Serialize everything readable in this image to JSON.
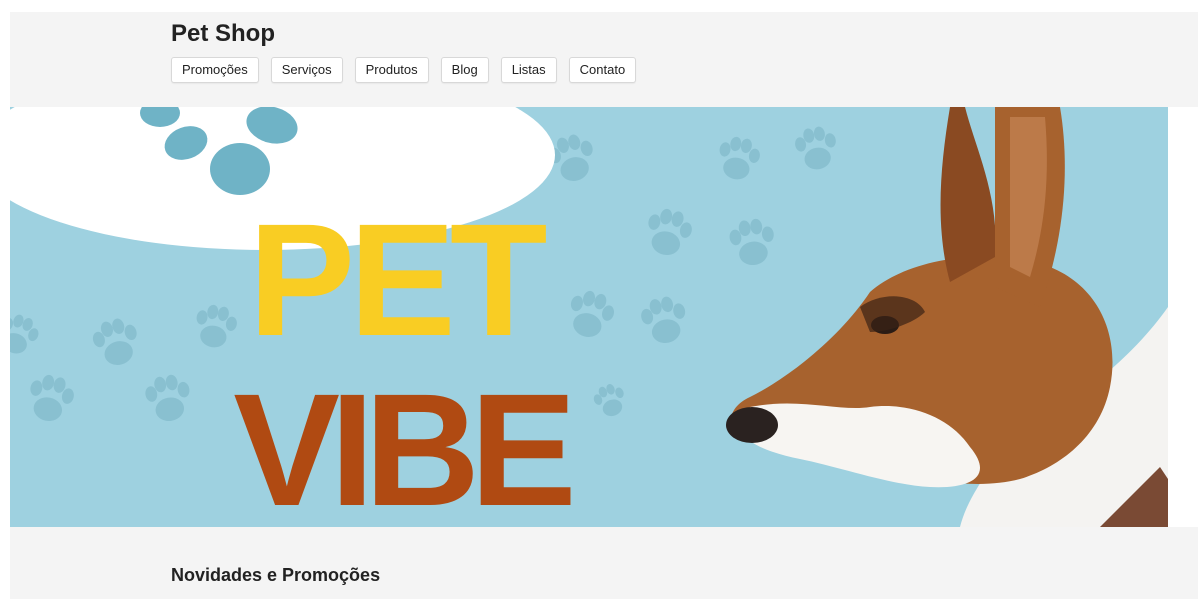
{
  "header": {
    "title": "Pet Shop",
    "nav": [
      {
        "label": "Promoções"
      },
      {
        "label": "Serviços"
      },
      {
        "label": "Produtos"
      },
      {
        "label": "Blog"
      },
      {
        "label": "Listas"
      },
      {
        "label": "Contato"
      }
    ]
  },
  "banner": {
    "line1": "PET",
    "line2": "VIBE",
    "colors": {
      "background": "#9ed1e0",
      "paw": "#6fb3c6",
      "pet_text": "#f9cd23",
      "vibe_text": "#b04a12"
    }
  },
  "section": {
    "title": "Novidades e Promoções"
  }
}
